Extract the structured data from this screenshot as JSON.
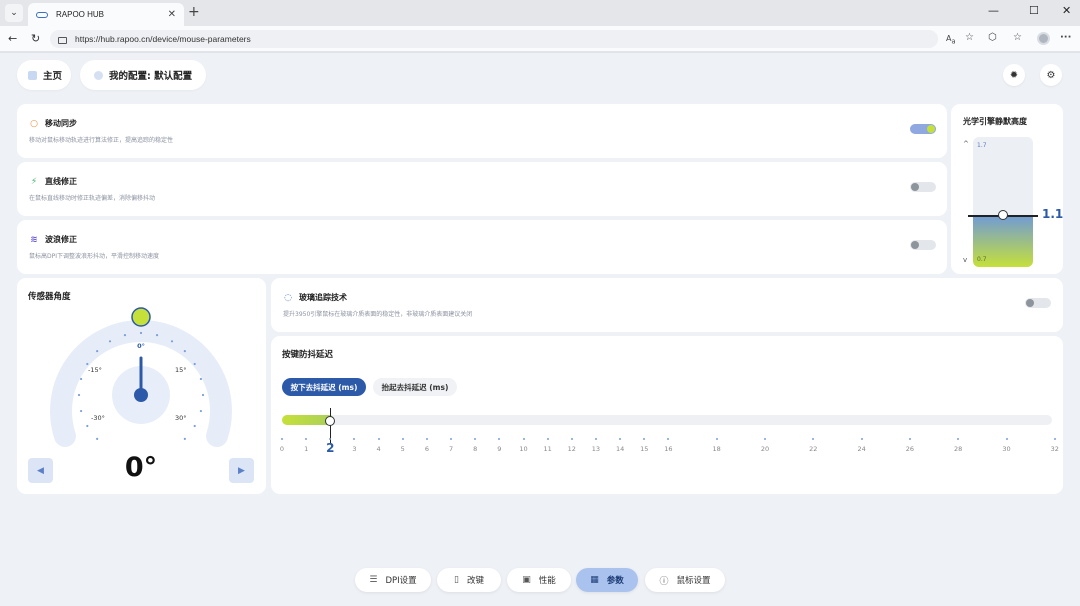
{
  "browser": {
    "tab_title": "RAPOO HUB",
    "url": "https://hub.rapoo.cn/device/mouse-parameters",
    "new_tab": "+",
    "close": "✕",
    "min": "—",
    "max": "☐",
    "win_close": "✕",
    "menu_icon": "chevron-down-icon",
    "more": "···"
  },
  "header": {
    "home_label": "主页",
    "profile_label": "我的配置: 默认配置",
    "theme_icon": "sun-icon",
    "settings_icon": "gear-icon"
  },
  "settings_rows": [
    {
      "title": "移动同步",
      "desc": "移动对鼠标移动轨迹进行算法修正，提高追踪的稳定性",
      "enabled": true,
      "icon_color": "#f08a3c"
    },
    {
      "title": "直线修正",
      "desc": "在鼠标直线移动时修正轨迹偏差，消除偏移抖动",
      "enabled": false,
      "icon_color": "#3fae6a"
    },
    {
      "title": "波浪修正",
      "desc": "鼠标高DPI下调整波浪形抖动，平滑控制移动速度",
      "enabled": false,
      "icon_color": "#6b5bd6"
    }
  ],
  "lod": {
    "title": "光学引擎静默高度",
    "max_label": "1.7",
    "min_label": "0.7",
    "value": "1.1",
    "up": "^",
    "down": "v",
    "level": 0.4
  },
  "sensor": {
    "title": "传感器角度",
    "value": "0°",
    "ticks": [
      {
        "label": "0°"
      },
      {
        "label": "-15°"
      },
      {
        "label": "15°"
      },
      {
        "label": "-30°"
      },
      {
        "label": "30°"
      }
    ]
  },
  "glass": {
    "title": "玻璃追踪技术",
    "desc": "提升3950引擎鼠标在玻璃介质表面的稳定性，非玻璃介质表面建议关闭",
    "enabled": false
  },
  "debounce": {
    "title": "按键防抖延迟",
    "tabs": [
      {
        "label": "按下去抖延迟 (ms)",
        "active": true
      },
      {
        "label": "抬起去抖延迟 (ms)",
        "active": false
      }
    ],
    "current": "2",
    "value": 2,
    "min": 0,
    "max": 32,
    "scale": [
      "0",
      "1",
      "2",
      "3",
      "4",
      "5",
      "6",
      "7",
      "8",
      "9",
      "10",
      "11",
      "12",
      "13",
      "14",
      "15",
      "16",
      "18",
      "20",
      "22",
      "24",
      "26",
      "28",
      "30",
      "32"
    ]
  },
  "bottom_nav": [
    {
      "label": "DPI设置",
      "icon": "sliders-icon",
      "active": false
    },
    {
      "label": "改键",
      "icon": "mouse-icon",
      "active": false
    },
    {
      "label": "性能",
      "icon": "chip-icon",
      "active": false
    },
    {
      "label": "参数",
      "icon": "grid-icon",
      "active": true
    },
    {
      "label": "鼠标设置",
      "icon": "info-icon",
      "active": false
    }
  ],
  "colors": {
    "accent": "#2c5aa8",
    "lime": "#c6e03a",
    "toggle_on": "#8fa8e0"
  }
}
